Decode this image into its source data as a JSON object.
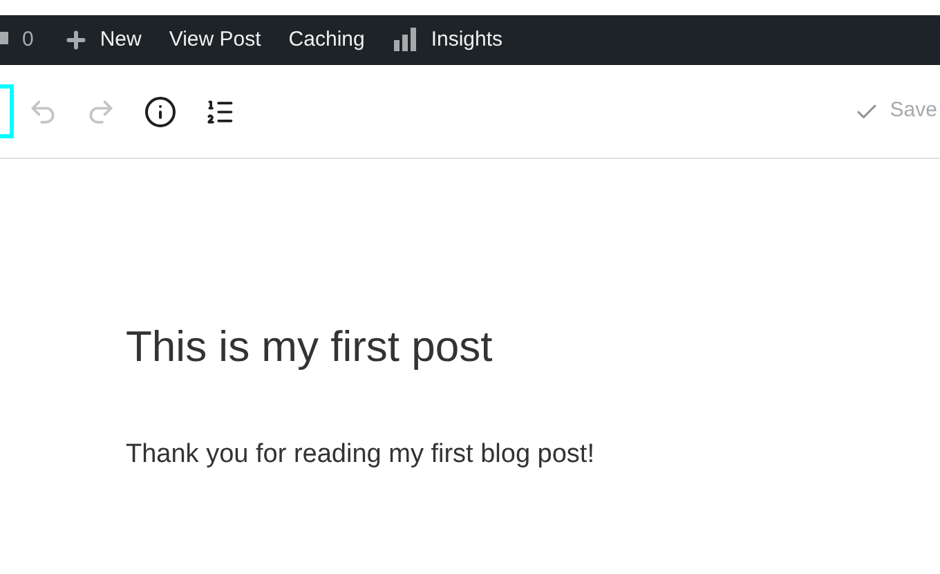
{
  "admin_bar": {
    "comments_count": "0",
    "items": [
      "New",
      "View Post",
      "Caching",
      "Insights"
    ]
  },
  "toolbar": {
    "undo": {
      "disabled": true
    },
    "redo": {
      "disabled": true
    },
    "save_status": "Save"
  },
  "post": {
    "title": "This is my first post",
    "paragraph": "Thank you for reading my first blog post!"
  }
}
